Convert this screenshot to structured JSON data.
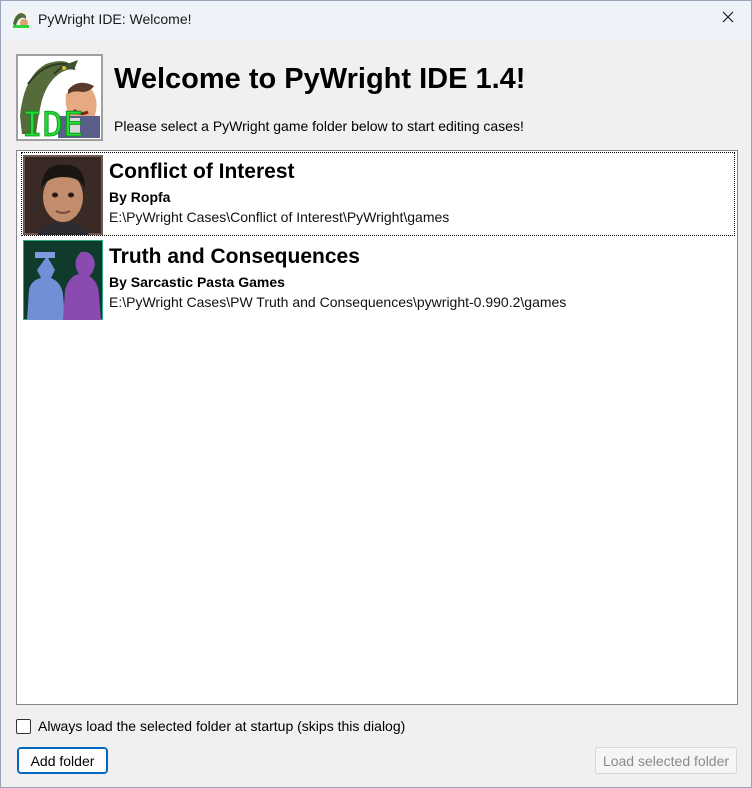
{
  "window": {
    "title": "PyWright IDE: Welcome!",
    "close_glyph": "✕"
  },
  "header": {
    "logo_icon": "pywright-ide-logo-icon",
    "logo_text": "IDE",
    "title": "Welcome to PyWright IDE 1.4!",
    "subtitle": "Please select a PyWright game folder below to start editing cases!"
  },
  "games": [
    {
      "title": "Conflict of Interest",
      "author": "By Ropfa",
      "path": "E:\\PyWright Cases\\Conflict of Interest\\PyWright\\games",
      "selected": true
    },
    {
      "title": "Truth and Consequences",
      "author": "By Sarcastic Pasta Games",
      "path": "E:\\PyWright Cases\\PW Truth and Consequences\\pywright-0.990.2\\games",
      "selected": false
    }
  ],
  "startup": {
    "checked": false,
    "label": "Always load the selected folder at startup (skips this dialog)"
  },
  "buttons": {
    "add_folder": "Add folder",
    "load_selected": "Load selected folder"
  },
  "colors": {
    "accent": "#0067c0",
    "logo_text_green": "#22dd33",
    "disabled_text": "#8a8a8a"
  }
}
